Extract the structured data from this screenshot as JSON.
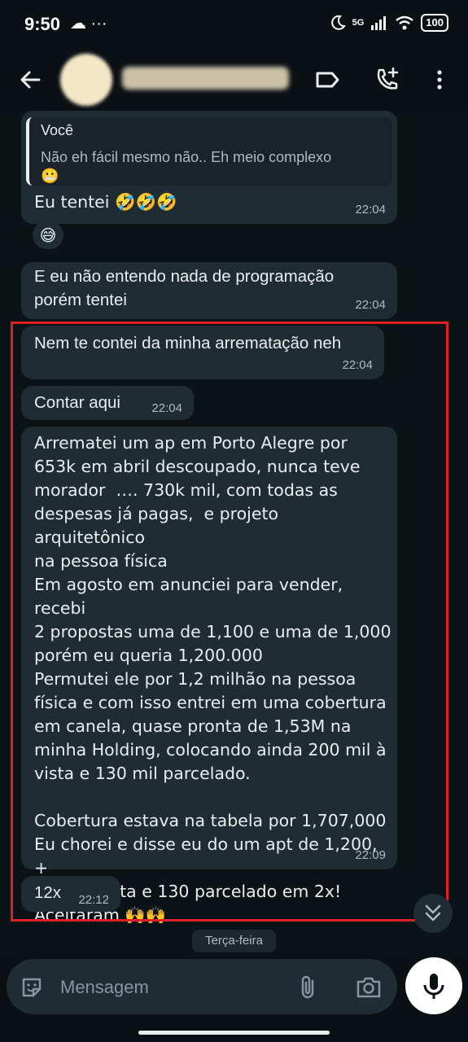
{
  "status_bar": {
    "time": "9:50",
    "left_icons": "☁ ···",
    "network": "5G",
    "battery": "100"
  },
  "header": {
    "icons": [
      "back-arrow-icon",
      "label-icon",
      "add-call-icon",
      "more-vert-icon"
    ]
  },
  "messages": [
    {
      "quote_author": "Você",
      "quote_text": "Não eh fácil mesmo não.. Eh meio complexo",
      "quote_emoji": "😬",
      "text": "Eu tentei 🤣🤣🤣",
      "time": "22:04"
    },
    {
      "reaction": "😅"
    },
    {
      "text": "E eu não entendo nada de programação\nporém tentei",
      "time": "22:04"
    },
    {
      "text": "Nem te contei da minha arrematação neh",
      "time": "22:04"
    },
    {
      "text": "Contar aqui",
      "time": "22:04"
    },
    {
      "text": "Arrematei um ap em Porto Alegre por\n653k em abril descoupado, nunca teve\nmorador  …. 730k mil, com todas as\ndespesas já pagas,  e projeto arquitetônico\nna pessoa física\nEm agosto em anunciei para vender, recebi\n2 propostas uma de 1,100 e uma de 1,000\nporém eu queria 1,200.000\nPermutei ele por 1,2 milhão na pessoa\nfísica e com isso entrei em uma cobertura\nem canela, quase pronta de 1,53M na\nminha Holding, colocando ainda 200 mil à\nvista e 130 mil parcelado.\n\nCobertura estava na tabela por 1,707,000\nEu chorei e disse eu do um apt de 1,200, +\n200k à vista e 130 parcelado em 2x!\nAceitaram 🙌🙌",
      "time": "22:09"
    },
    {
      "text": "12x",
      "time": "22:12"
    }
  ],
  "day_chip": "Terça-feira",
  "composer": {
    "placeholder": "Mensagem",
    "icons": [
      "sticker-icon",
      "attach-icon",
      "camera-icon",
      "mic-icon"
    ]
  },
  "colors": {
    "background": "#0b1014",
    "bubble": "#202c33",
    "highlight_border": "#e02029",
    "timestamp": "#aebac1"
  }
}
